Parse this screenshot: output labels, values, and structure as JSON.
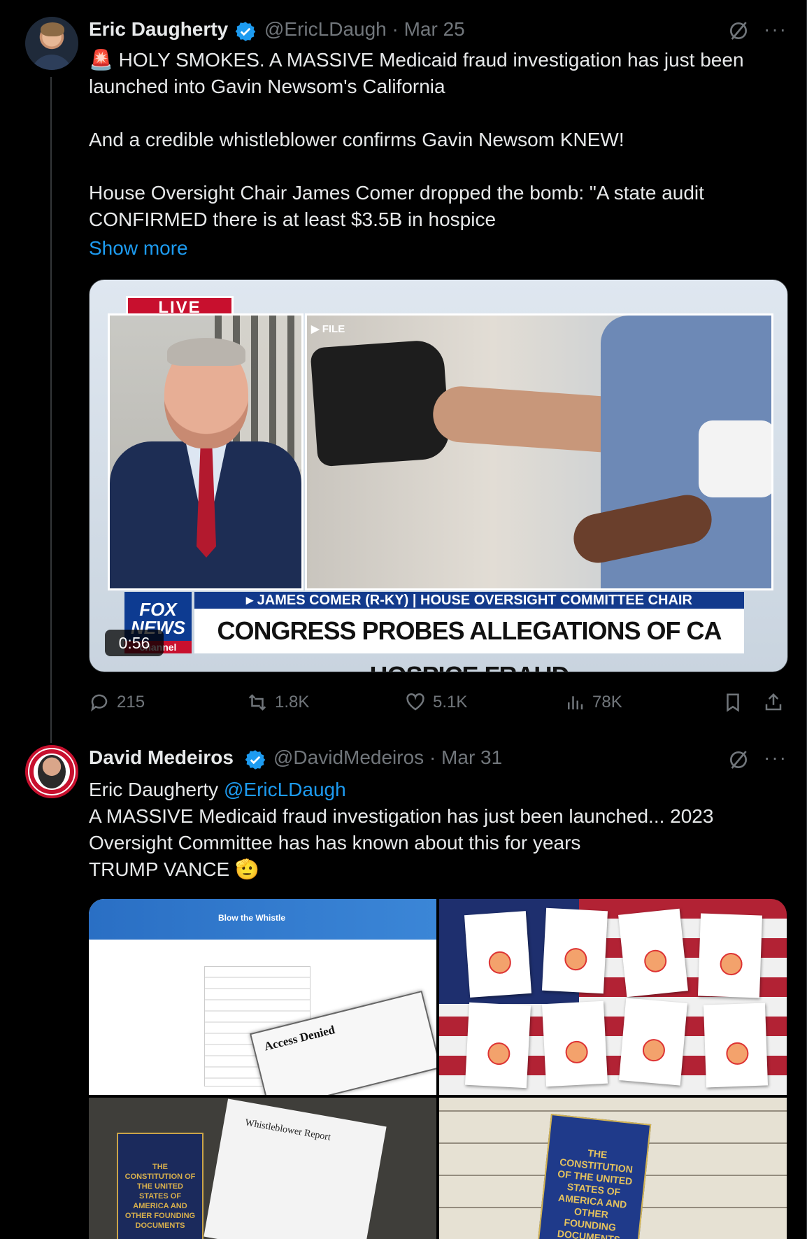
{
  "tweet1": {
    "name": "Eric Daugherty",
    "handle_date": "@EricLDaugh · Mar 25",
    "text": "🚨 HOLY SMOKES. A MASSIVE Medicaid fraud investigation has just been launched into Gavin Newsom's California\n\nAnd a credible whistleblower confirms Gavin Newsom KNEW!\n\nHouse Oversight Chair James Comer dropped the bomb: \"A state audit CONFIRMED there is at least $3.5B in hospice",
    "show_more": "Show more",
    "media": {
      "live": "LIVE",
      "file": "▶ FILE",
      "lower_third_top": "▸ JAMES COMER (R-KY) | HOUSE OVERSIGHT COMMITTEE CHAIR",
      "lower_third_main": "CONGRESS PROBES ALLEGATIONS OF CA HOSPICE FRAUD",
      "logo_line1": "FOX",
      "logo_line2": "NEWS",
      "logo_line3": "channel",
      "duration": "0:56"
    },
    "stats": {
      "replies": "215",
      "reposts": "1.8K",
      "likes": "5.1K",
      "views": "78K"
    }
  },
  "tweet2": {
    "name": "David Medeiros",
    "handle_date": "@DavidMedeiros · Mar 31",
    "mention_name": "Eric Daugherty",
    "mention_handle": "@EricLDaugh",
    "text": "A MASSIVE Medicaid fraud investigation has just been launched... 2023\nOversight Committee has has known about this for years\nTRUMP VANCE 🫡",
    "images": {
      "blow_whistle": "Blow the Whistle",
      "access_denied": "Access Denied",
      "report_title": "Whistleblower Report",
      "book_title": "THE CONSTITUTION OF THE UNITED STATES OF AMERICA AND OTHER FOUNDING DOCUMENTS"
    }
  },
  "colors": {
    "background": "#000000",
    "text": "#e7e9ea",
    "muted": "#71767b",
    "link": "#1d9bf0"
  }
}
